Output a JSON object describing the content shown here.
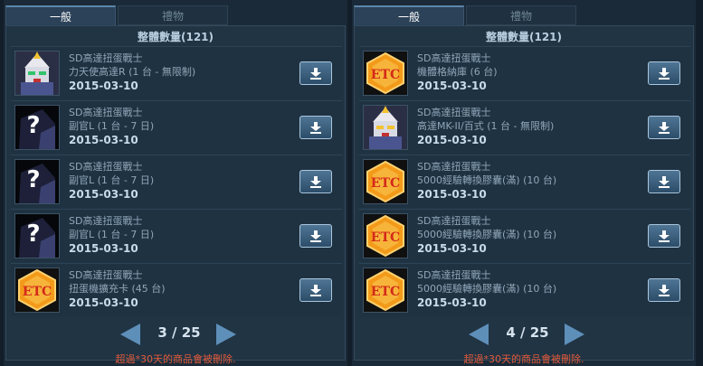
{
  "colors": {
    "notice": "#e25a3a",
    "accent": "#5d86aa"
  },
  "panels": [
    {
      "tab_general": "一般",
      "tab_gift": "禮物",
      "header": "整體數量(121)",
      "pagination": {
        "current": "3",
        "total": "25",
        "text": "3 / 25"
      },
      "notice": "超過*30天的商品會被刪除.",
      "items": [
        {
          "icon": "gundam-icon",
          "line1": "SD高達扭蛋戰士",
          "line2": "力天使高達R (1 台 - 無限制)",
          "line3": "2015-03-10"
        },
        {
          "icon": "mystery-icon",
          "line1": "SD高達扭蛋戰士",
          "line2": "副官L (1 台 - 7 日)",
          "line3": "2015-03-10"
        },
        {
          "icon": "mystery-icon",
          "line1": "SD高達扭蛋戰士",
          "line2": "副官L (1 台 - 7 日)",
          "line3": "2015-03-10"
        },
        {
          "icon": "mystery-icon",
          "line1": "SD高達扭蛋戰士",
          "line2": "副官L (1 台 - 7 日)",
          "line3": "2015-03-10"
        },
        {
          "icon": "etc-icon",
          "line1": "SD高達扭蛋戰士",
          "line2": "扭蛋機擴充卡 (45 台)",
          "line3": "2015-03-10"
        }
      ]
    },
    {
      "tab_general": "一般",
      "tab_gift": "禮物",
      "header": "整體數量(121)",
      "pagination": {
        "current": "4",
        "total": "25",
        "text": "4 / 25"
      },
      "notice": "超過*30天的商品會被刪除.",
      "items": [
        {
          "icon": "etc-icon",
          "line1": "SD高達扭蛋戰士",
          "line2": "機體格納庫 (6 台)",
          "line3": "2015-03-10"
        },
        {
          "icon": "gundam-icon",
          "line1": "SD高達扭蛋戰士",
          "line2": "高達MK-II/百式 (1 台 - 無限制)",
          "line3": "2015-03-10"
        },
        {
          "icon": "etc-icon",
          "line1": "SD高達扭蛋戰士",
          "line2": "5000經驗轉換膠囊(滿) (10 台)",
          "line3": "2015-03-10"
        },
        {
          "icon": "etc-icon",
          "line1": "SD高達扭蛋戰士",
          "line2": "5000經驗轉換膠囊(滿) (10 台)",
          "line3": "2015-03-10"
        },
        {
          "icon": "etc-icon",
          "line1": "SD高達扭蛋戰士",
          "line2": "5000經驗轉換膠囊(滿) (10 台)",
          "line3": "2015-03-10"
        }
      ]
    }
  ]
}
